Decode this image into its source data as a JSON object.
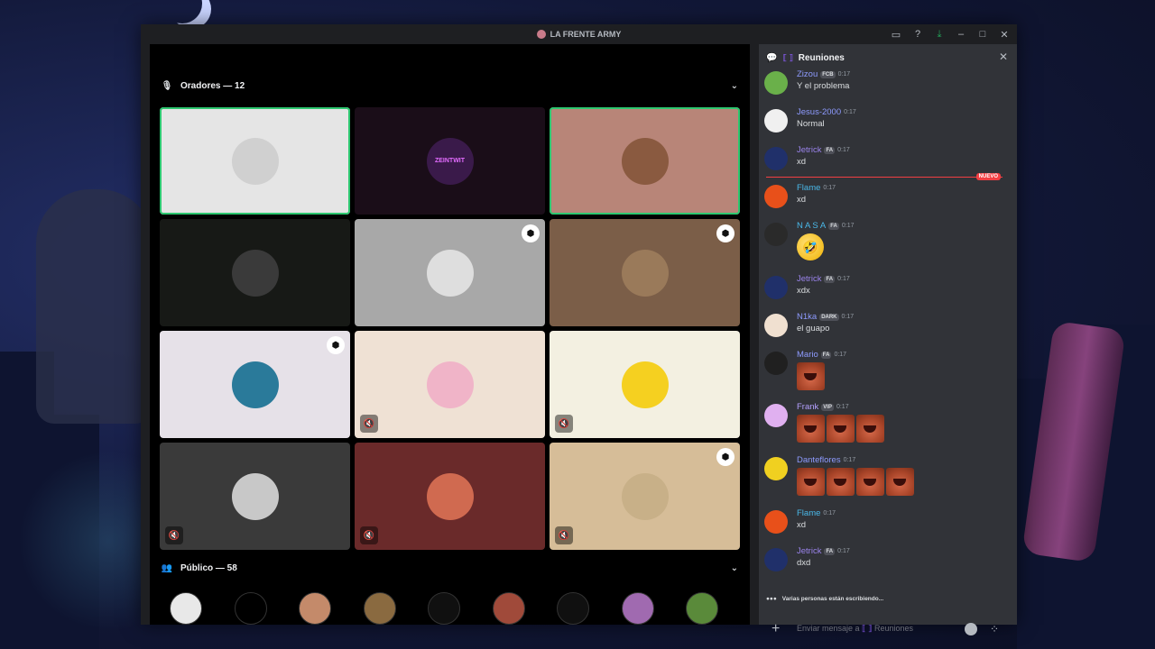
{
  "window": {
    "title": "LA FRENTE ARMY"
  },
  "stage": {
    "speakers_label": "Oradores — 12",
    "audience_label": "Público — 58",
    "tiles": [
      {
        "bg": "#e5e5e5",
        "speaking": true,
        "avatar_bg": "#d0d0d0",
        "badge": false,
        "muted": false
      },
      {
        "bg": "#1a0d18",
        "speaking": false,
        "avatar_bg": "#3a1a4a",
        "badge": false,
        "muted": false,
        "avatar_text": "ZEINTWIT"
      },
      {
        "bg": "#b88578",
        "speaking": true,
        "avatar_bg": "#8a5a40",
        "badge": false,
        "muted": false
      },
      {
        "bg": "#171916",
        "speaking": false,
        "avatar_bg": "#3a3a3a",
        "badge": false,
        "muted": false
      },
      {
        "bg": "#a8a8a8",
        "speaking": false,
        "avatar_bg": "#dedede",
        "badge": true,
        "muted": false
      },
      {
        "bg": "#7b5e48",
        "speaking": false,
        "avatar_bg": "#9a7a5a",
        "badge": true,
        "muted": false
      },
      {
        "bg": "#e6e1e8",
        "speaking": false,
        "avatar_bg": "#2a7a9a",
        "badge": true,
        "muted": false
      },
      {
        "bg": "#efe1d4",
        "speaking": false,
        "avatar_bg": "#f0b4c8",
        "badge": false,
        "muted": true
      },
      {
        "bg": "#f3f0e1",
        "speaking": false,
        "avatar_bg": "#f5d020",
        "badge": false,
        "muted": true
      },
      {
        "bg": "#3a3a3a",
        "speaking": false,
        "avatar_bg": "#c8c8c8",
        "badge": false,
        "muted": true
      },
      {
        "bg": "#6a2a2a",
        "speaking": false,
        "avatar_bg": "#d06a50",
        "badge": false,
        "muted": true
      },
      {
        "bg": "#d6bd98",
        "speaking": false,
        "avatar_bg": "#c8b088",
        "badge": true,
        "muted": true
      }
    ],
    "audience": [
      "#e8e8e8",
      "#000000",
      "#c48a6a",
      "#8a6a40",
      "#101010",
      "#a04a3a",
      "#101010",
      "#a06ab0",
      "#5a8a3a"
    ]
  },
  "chat": {
    "channel_name": "Reuniones",
    "new_label": "NUEVO",
    "typing_text": "Varias personas están escribiendo...",
    "composer_placeholder": "Enviar mensaje a",
    "composer_channel": "Reuniones",
    "messages": [
      {
        "name": "Zizou",
        "color": "#8e9bff",
        "tag": "FCB",
        "time": "0:17",
        "text": "Y el problema",
        "avatar": "#6ab04a"
      },
      {
        "name": "Jesus-2000",
        "color": "#8e9bff",
        "tag": "",
        "time": "0:17",
        "text": "Normal",
        "avatar": "#f0f0f0"
      },
      {
        "name": "Jetrick",
        "color": "#9b84ec",
        "tag": "FA",
        "time": "0:17",
        "text": "xd",
        "avatar": "#20306a"
      },
      {
        "name": "Flame",
        "color": "#4ab8e8",
        "tag": "",
        "time": "0:17",
        "text": "xd",
        "avatar": "#e8501a"
      },
      {
        "name": "N A S A",
        "color": "#4ab8e8",
        "tag": "FA",
        "time": "0:17",
        "text": "",
        "avatar": "#2a2a2a",
        "big_emoji": "🤣"
      },
      {
        "name": "Jetrick",
        "color": "#9b84ec",
        "tag": "FA",
        "time": "0:17",
        "text": "xdx",
        "avatar": "#20306a"
      },
      {
        "name": "N1ka",
        "color": "#8e9bff",
        "tag": "DARK",
        "time": "0:17",
        "text": "el guapo",
        "avatar": "#f0e0d0"
      },
      {
        "name": "Mario",
        "color": "#8e9bff",
        "tag": "FA",
        "time": "0:17",
        "text": "",
        "avatar": "#202020",
        "emojis": 1
      },
      {
        "name": "Frank",
        "color": "#b5a0ff",
        "tag": "VIP",
        "time": "0:17",
        "text": "",
        "avatar": "#e0b0f0",
        "emojis": 3
      },
      {
        "name": "Danteflores",
        "color": "#8e9bff",
        "tag": "",
        "time": "0:17",
        "text": "",
        "avatar": "#f0d020",
        "emojis": 4
      },
      {
        "name": "Flame",
        "color": "#4ab8e8",
        "tag": "",
        "time": "0:17",
        "text": "xd",
        "avatar": "#e8501a"
      },
      {
        "name": "Jetrick",
        "color": "#9b84ec",
        "tag": "FA",
        "time": "0:17",
        "text": "dxd",
        "avatar": "#20306a"
      }
    ]
  }
}
